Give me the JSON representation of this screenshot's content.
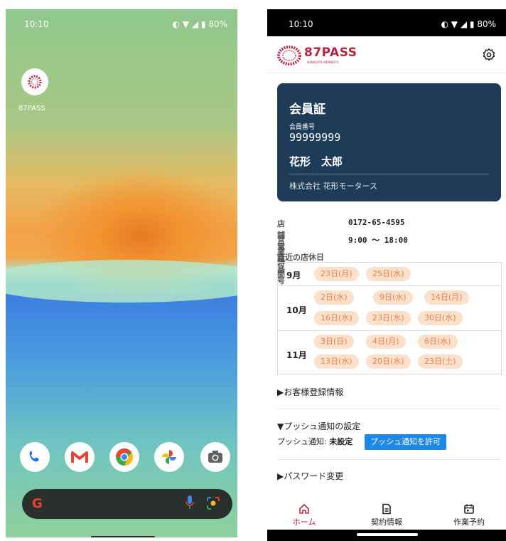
{
  "home_screen": {
    "status": {
      "time": "10:10",
      "battery": "80%"
    },
    "app_icon_label": "87PASS",
    "dock_apps": [
      "phone-icon",
      "gmail-icon",
      "chrome-icon",
      "photos-icon",
      "camera-icon"
    ],
    "search_logo": "G"
  },
  "app_screen": {
    "status": {
      "time": "10:10",
      "battery": "80%"
    },
    "brand": {
      "name": "87PASS",
      "sub": "HANAGATA MEMBER'S"
    },
    "member_card": {
      "title": "会員証",
      "number_label": "会員番号",
      "number": "99999999",
      "name": "花形　太郎",
      "company": "株式会社 花形モータース"
    },
    "store_info": {
      "phone_label": "店舗電話番号",
      "phone": "0172-65-4595",
      "hours_label": "営業時間",
      "hours": "9:00 ～ 18:00"
    },
    "closed_days_title": "直近の店休日",
    "closed_days": [
      {
        "month": "9月",
        "days": [
          "23日(月)",
          "25日(水)"
        ]
      },
      {
        "month": "10月",
        "days": [
          "2日(水)",
          "9日(水)",
          "14日(月)",
          "16日(水)",
          "23日(水)",
          "30日(水)"
        ]
      },
      {
        "month": "11月",
        "days": [
          "3日(日)",
          "4日(月)",
          "6日(水)",
          "13日(水)",
          "20日(水)",
          "23日(土)"
        ]
      }
    ],
    "sections": {
      "customer_info": "▶お客様登録情報",
      "push_settings": "▼プッシュ通知の設定",
      "push_label": "プッシュ通知:",
      "push_status": "未設定",
      "push_button": "プッシュ通知を許可",
      "password_change": "▶パスワード変更"
    },
    "tabs": [
      {
        "label": "ホーム",
        "icon": "home-icon",
        "active": true
      },
      {
        "label": "契約情報",
        "icon": "document-icon",
        "active": false
      },
      {
        "label": "作業予約",
        "icon": "calendar-icon",
        "active": false
      }
    ],
    "colors": {
      "brand": "#b2263e",
      "card": "#1e3b58",
      "chip_bg": "#fbe0cc",
      "chip_text": "#e8824a",
      "button": "#1e88e5"
    }
  }
}
